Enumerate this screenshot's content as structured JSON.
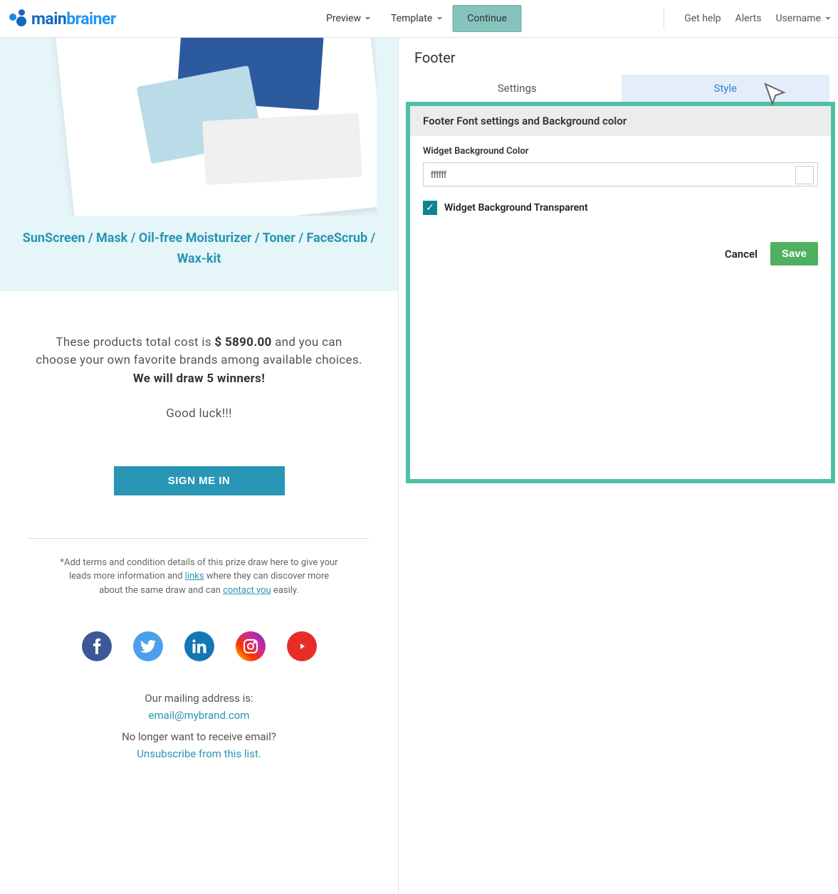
{
  "brand": {
    "main": "main",
    "brainer": "brainer"
  },
  "nav": {
    "preview": "Preview",
    "template": "Template",
    "continue": "Continue",
    "gethelp": "Get help",
    "alerts": "Alerts",
    "username": "Username"
  },
  "hero": {
    "categories": "SunScreen / Mask / Oil-free Moisturizer / Toner / FaceScrub / Wax-kit"
  },
  "info": {
    "pre": "These products total cost is ",
    "price": "$ 5890.00",
    "mid": " and you can choose your own favorite brands among available choices. ",
    "winners": "We will draw 5 winners!",
    "luck": "Good luck!!!"
  },
  "cta": {
    "label": "SIGN ME IN"
  },
  "terms": {
    "t1": "*Add terms and condition details of this prize draw here to give your leads more information and ",
    "links": "links",
    "t2": " where they can discover more about the same draw and can ",
    "contact": "contact you",
    "t3": " easily."
  },
  "footer": {
    "mailLabel": "Our mailing address is:",
    "email": "email@mybrand.com",
    "unsubPrompt": "No longer want to receive email?",
    "unsubLink": "Unsubscribe from this list."
  },
  "panel": {
    "title": "Footer",
    "tabSettings": "Settings",
    "tabStyle": "Style"
  },
  "section": {
    "header": "Footer Font settings and Background color",
    "bgLabel": "Widget Background Color",
    "bgValue": "ffffff",
    "transparentLabel": "Widget Background Transparent"
  },
  "actions": {
    "cancel": "Cancel",
    "save": "Save"
  },
  "social": {
    "fb": "f",
    "tw": "t",
    "li": "in",
    "ig": "ig",
    "yt": "▶"
  }
}
